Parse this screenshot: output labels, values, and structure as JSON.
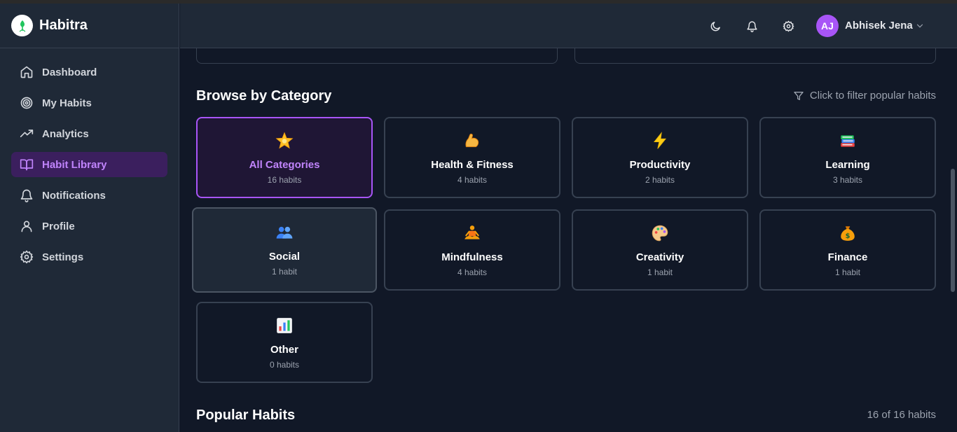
{
  "app": {
    "name": "Habitra"
  },
  "sidebar": {
    "items": [
      {
        "label": "Dashboard",
        "icon": "home-icon"
      },
      {
        "label": "My Habits",
        "icon": "target-icon"
      },
      {
        "label": "Analytics",
        "icon": "trending-up-icon"
      },
      {
        "label": "Habit Library",
        "icon": "book-open-icon",
        "active": true
      },
      {
        "label": "Notifications",
        "icon": "bell-icon"
      },
      {
        "label": "Profile",
        "icon": "user-icon"
      },
      {
        "label": "Settings",
        "icon": "gear-icon"
      }
    ]
  },
  "header": {
    "user": {
      "initials": "AJ",
      "name": "Abhisek Jena"
    },
    "icons": [
      "moon-icon",
      "bell-icon",
      "gear-icon",
      "chevron-down-icon"
    ]
  },
  "browse": {
    "title": "Browse by Category",
    "filter_hint": "Click to filter popular habits",
    "categories": [
      {
        "name": "All Categories",
        "count": "16 habits",
        "icon": "star-icon",
        "selected": true
      },
      {
        "name": "Health & Fitness",
        "count": "4 habits",
        "icon": "flexed-biceps-icon"
      },
      {
        "name": "Productivity",
        "count": "2 habits",
        "icon": "lightning-icon"
      },
      {
        "name": "Learning",
        "count": "3 habits",
        "icon": "books-icon"
      },
      {
        "name": "Social",
        "count": "1 habit",
        "icon": "people-icon"
      },
      {
        "name": "Mindfulness",
        "count": "4 habits",
        "icon": "meditation-icon"
      },
      {
        "name": "Creativity",
        "count": "1 habit",
        "icon": "palette-icon"
      },
      {
        "name": "Finance",
        "count": "1 habit",
        "icon": "money-bag-icon"
      },
      {
        "name": "Other",
        "count": "0 habits",
        "icon": "bar-chart-icon"
      }
    ]
  },
  "popular": {
    "title": "Popular Habits",
    "count": "16 of 16 habits"
  },
  "colors": {
    "accent": "#a855f7",
    "accent_text": "#c084fc",
    "background": "#111827",
    "panel": "#1f2937",
    "border": "#374151"
  }
}
